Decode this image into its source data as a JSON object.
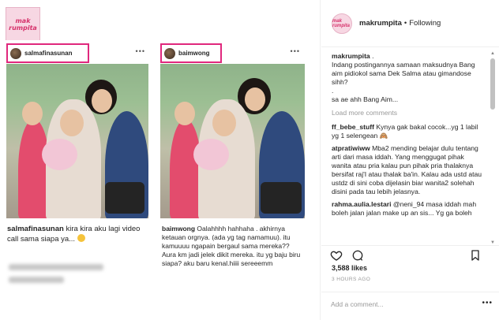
{
  "brand": {
    "logo_line1": "mak",
    "logo_line2": "rumpita"
  },
  "screenshots": [
    {
      "username": "salmafinasunan",
      "caption_user": "salmafinasunan",
      "caption_text": " kira kira aku lagi video call sama siapa ya..."
    },
    {
      "username": "baimwong",
      "caption_user": "baimwong",
      "caption_text": " Oalahhhh hahhaha . akhirnya ketauan orgnya. (ada yg tag namamuu). itu kamuuuu ngapain bergaul sama mereka?? Aura km jadi jelek dikit mereka. itu yg baju biru siapa? aku baru kenal.hiiii sereeemm"
    }
  ],
  "header": {
    "avatar_text": "mak rumpita",
    "username": "makrumpita",
    "separator": "•",
    "follow_status": "Following"
  },
  "post_caption": {
    "user": "makrumpita",
    "line1": " .",
    "body": "Indang postingannya samaan maksudnya Bang aim pidiokol sama Dek Salma atau gimandose sihh?",
    "dot": ".",
    "tail": "sa ae ahh Bang Aim..."
  },
  "load_more": "Load more comments",
  "comments": [
    {
      "user": "ff_bebe_stuff",
      "text": " Kynya gak bakal cocok...yg 1 labil yg 1 selengean 🙈"
    },
    {
      "user": "atpratiwiww",
      "text": " Mba2 mending belajar dulu tentang arti dari masa iddah. Yang menggugat pihak wanita atau pria kalau pun pihak pria thalaknya bersifat raj'I atau thalak ba'in. Kalau ada ustd atau ustdz di sini coba dijelasin biar wanita2 solehah disini pada tau lebih jelasnya."
    },
    {
      "user": "rahma.aulia.lestari",
      "text": " @neni_94 masa iddah mah boleh jalan jalan make up an sis... Yg ga boleh selama masa iddah itu nikah"
    }
  ],
  "likes": "3,588 likes",
  "timestamp": "3 HOURS AGO",
  "add_comment_placeholder": "Add a comment...",
  "colors": {
    "highlight": "#e0287d",
    "muted": "#999999",
    "text": "#262626"
  },
  "icons": [
    "heart-icon",
    "comment-icon",
    "bookmark-icon",
    "more-options-icon"
  ]
}
